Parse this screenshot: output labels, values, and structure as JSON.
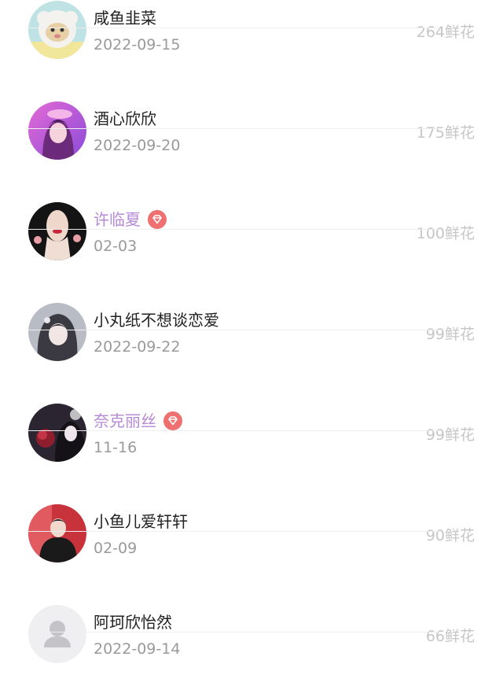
{
  "flower_unit": "鲜花",
  "colors": {
    "name": "#222222",
    "vip_name": "#b68ad6",
    "date": "#9a9a9a",
    "count": "#c6c6c6",
    "vip_badge": "#ee7070"
  },
  "entries": [
    {
      "name": "咸鱼韭菜",
      "date": "2022-09-15",
      "flowers": "264鲜花",
      "vip": false,
      "avatar": "sheep-cartoon-avatar"
    },
    {
      "name": "酒心欣欣",
      "date": "2022-09-20",
      "flowers": "175鲜花",
      "vip": false,
      "avatar": "pink-anime-girl-avatar"
    },
    {
      "name": "许临夏",
      "date": "02-03",
      "flowers": "100鲜花",
      "vip": true,
      "avatar": "girl-red-lips-avatar"
    },
    {
      "name": "小丸纸不想谈恋爱",
      "date": "2022-09-22",
      "flowers": "99鲜花",
      "vip": false,
      "avatar": "anime-girl-dark-hair-avatar"
    },
    {
      "name": "奈克丽丝",
      "date": "11-16",
      "flowers": "99鲜花",
      "vip": true,
      "avatar": "dark-floral-avatar"
    },
    {
      "name": "小鱼儿爱轩轩",
      "date": "02-09",
      "flowers": "90鲜花",
      "vip": false,
      "avatar": "man-red-background-avatar"
    },
    {
      "name": "阿珂欣怡然",
      "date": "2022-09-14",
      "flowers": "66鲜花",
      "vip": false,
      "avatar": "default-user-avatar"
    }
  ]
}
